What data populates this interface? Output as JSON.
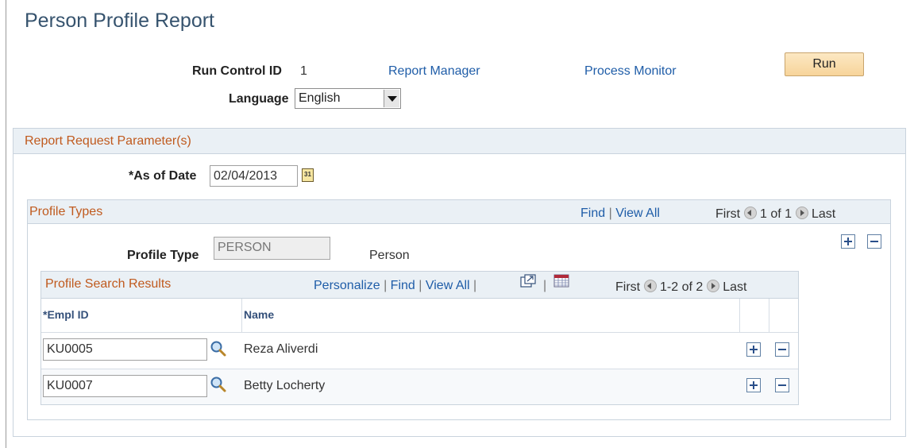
{
  "page": {
    "title": "Person Profile Report"
  },
  "run_control": {
    "label": "Run Control ID",
    "value": "1",
    "report_manager": "Report Manager",
    "process_monitor": "Process Monitor",
    "run_button": "Run",
    "language_label": "Language",
    "language_value": "English"
  },
  "parameters": {
    "title": "Report Request Parameter(s)",
    "as_of_date_label": "*As of Date",
    "as_of_date_value": "02/04/2013"
  },
  "profile_types": {
    "title": "Profile Types",
    "find": "Find",
    "sep": "|",
    "view_all": "View All",
    "first": "First",
    "count": "1 of 1",
    "last": "Last",
    "profile_type_label": "Profile Type",
    "profile_type_value": "PERSON",
    "profile_type_desc": "Person"
  },
  "search_results": {
    "title": "Profile Search Results",
    "personalize": "Personalize",
    "find": "Find",
    "view_all": "View All",
    "sep": "|",
    "first": "First",
    "count": "1-2 of 2",
    "last": "Last",
    "columns": {
      "empl_id": "*Empl ID",
      "name": "Name"
    },
    "rows": [
      {
        "empl_id": "KU0005",
        "name": "Reza Aliverdi"
      },
      {
        "empl_id": "KU0007",
        "name": "Betty Locherty"
      }
    ]
  },
  "icons": {
    "calendar": "calendar-icon",
    "prev": "previous-icon",
    "next": "next-icon",
    "add_row": "plus-icon",
    "delete_row": "minus-icon",
    "lookup": "magnifier-icon",
    "zoom": "zoom-icon",
    "download": "spreadsheet-icon"
  },
  "colors": {
    "link": "#1f5da8",
    "section_title": "#c05a1e",
    "header_bar": "#eaf0f5",
    "run_button": "#f7d49a"
  }
}
